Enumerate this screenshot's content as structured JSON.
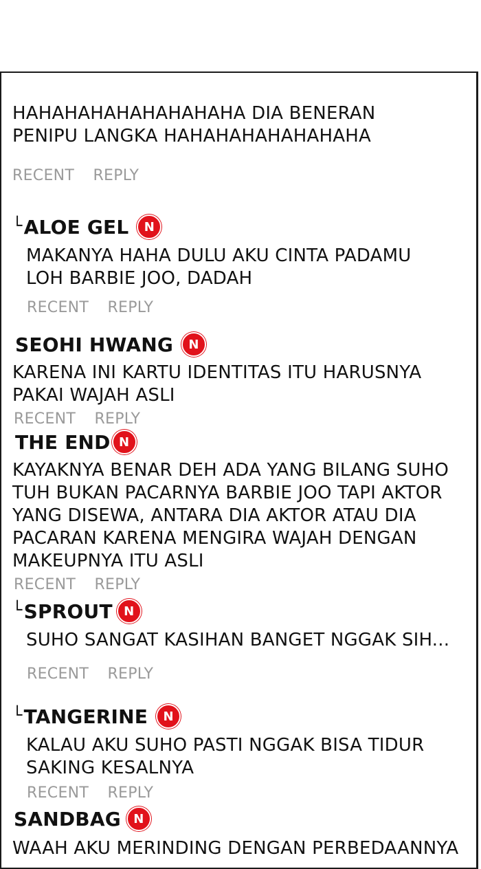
{
  "colors": {
    "badge": "#e1121b",
    "action_text": "#9a9a9a",
    "border": "#1a1a1a"
  },
  "badge_icon": "naver-n-icon",
  "comments": [
    {
      "id": "c0",
      "text": "HAHAHAHAHAHAHAHAHA DIA BENERAN PENIPU LANGKA HAHAHAHAHAHAHAHA",
      "recent": "RECENT",
      "reply": "REPLY"
    },
    {
      "id": "c1",
      "corner": "└",
      "name": "ALOE GEL",
      "badge": "N",
      "text": "MAKANYA HAHA DULU AKU CINTA PADAMU LOH BARBIE JOO, DADAH",
      "recent": "RECENT",
      "reply": "REPLY"
    },
    {
      "id": "c2",
      "name": "SEOHI HWANG",
      "badge": "N",
      "text": "KARENA INI KARTU IDENTITAS ITU HARUSNYA PAKAI WAJAH ASLI",
      "recent": "RECENT",
      "reply": "REPLY"
    },
    {
      "id": "c3",
      "name": "THE END",
      "badge": "N",
      "text": "KAYAKNYA BENAR DEH ADA YANG BILANG SUHO TUH BUKAN PACARNYA BARBIE JOO TAPI AKTOR YANG DISEWA, ANTARA DIA AKTOR ATAU DIA PACARAN KARENA MENGIRA WAJAH DENGAN MAKEUPNYA ITU ASLI",
      "recent": "RECENT",
      "reply": "REPLY"
    },
    {
      "id": "c4",
      "corner": "└",
      "name": "SPROUT",
      "badge": "N",
      "text": "SUHO SANGAT KASIHAN BANGET NGGAK SIH...",
      "recent": "RECENT",
      "reply": "REPLY"
    },
    {
      "id": "c5",
      "corner": "└",
      "name": "TANGERINE",
      "badge": "N",
      "text": "KALAU AKU SUHO PASTI NGGAK BISA TIDUR SAKING KESALNYA",
      "recent": "RECENT",
      "reply": "REPLY"
    },
    {
      "id": "c6",
      "name": "SANDBAG",
      "badge": "N",
      "text": "WAAH AKU MERINDING DENGAN PERBEDAANNYA"
    }
  ]
}
